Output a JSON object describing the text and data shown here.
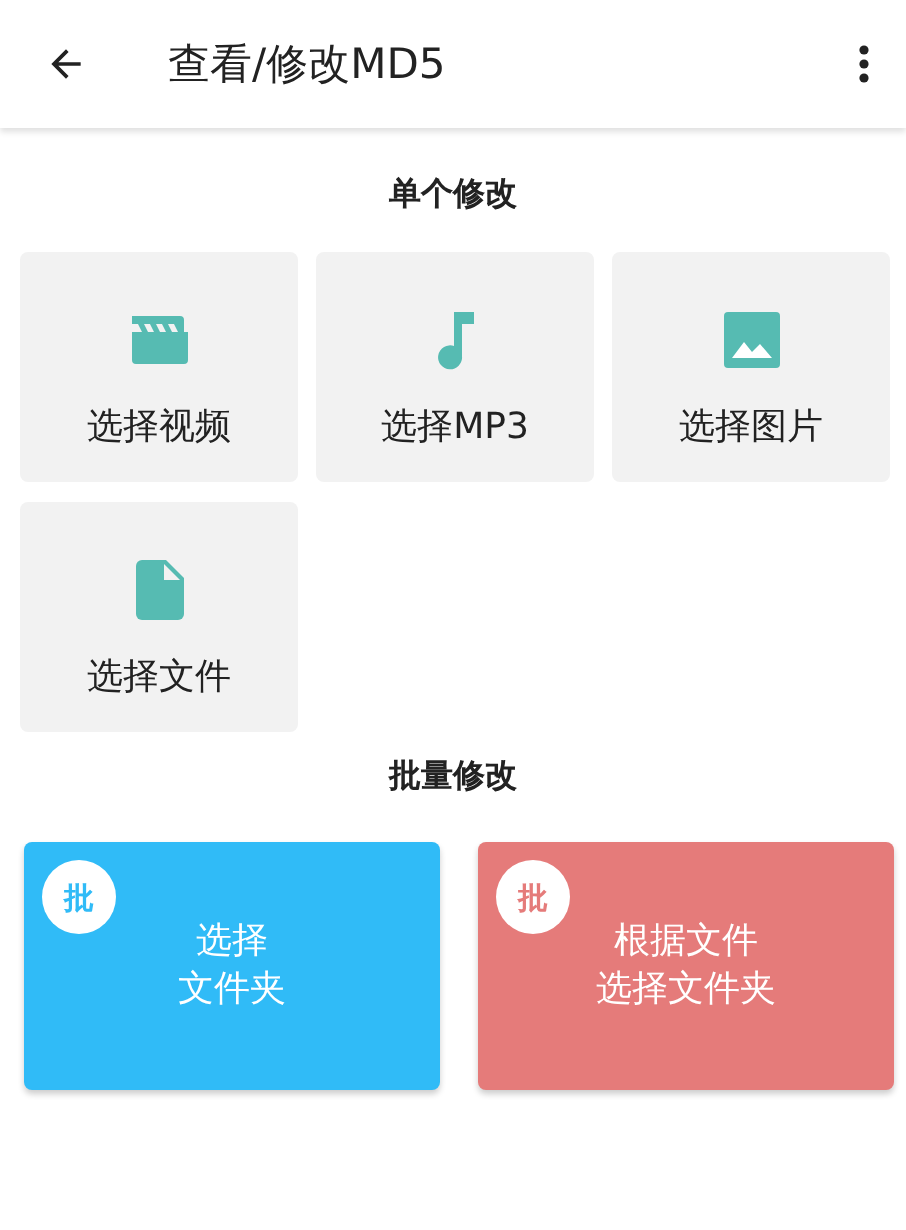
{
  "app_bar": {
    "title": "查看/修改MD5"
  },
  "single_section": {
    "title": "单个修改",
    "tiles": [
      {
        "kind": "video",
        "label": "选择视频"
      },
      {
        "kind": "music",
        "label": "选择MP3"
      },
      {
        "kind": "image",
        "label": "选择图片"
      },
      {
        "kind": "file",
        "label": "选择文件"
      }
    ]
  },
  "batch_section": {
    "title": "批量修改",
    "cards": [
      {
        "badge": "批",
        "lines": [
          "选择",
          "文件夹"
        ],
        "color": "#30bbf7"
      },
      {
        "badge": "批",
        "lines": [
          "根据文件",
          "选择文件夹"
        ],
        "color": "#e57b7a"
      }
    ]
  }
}
